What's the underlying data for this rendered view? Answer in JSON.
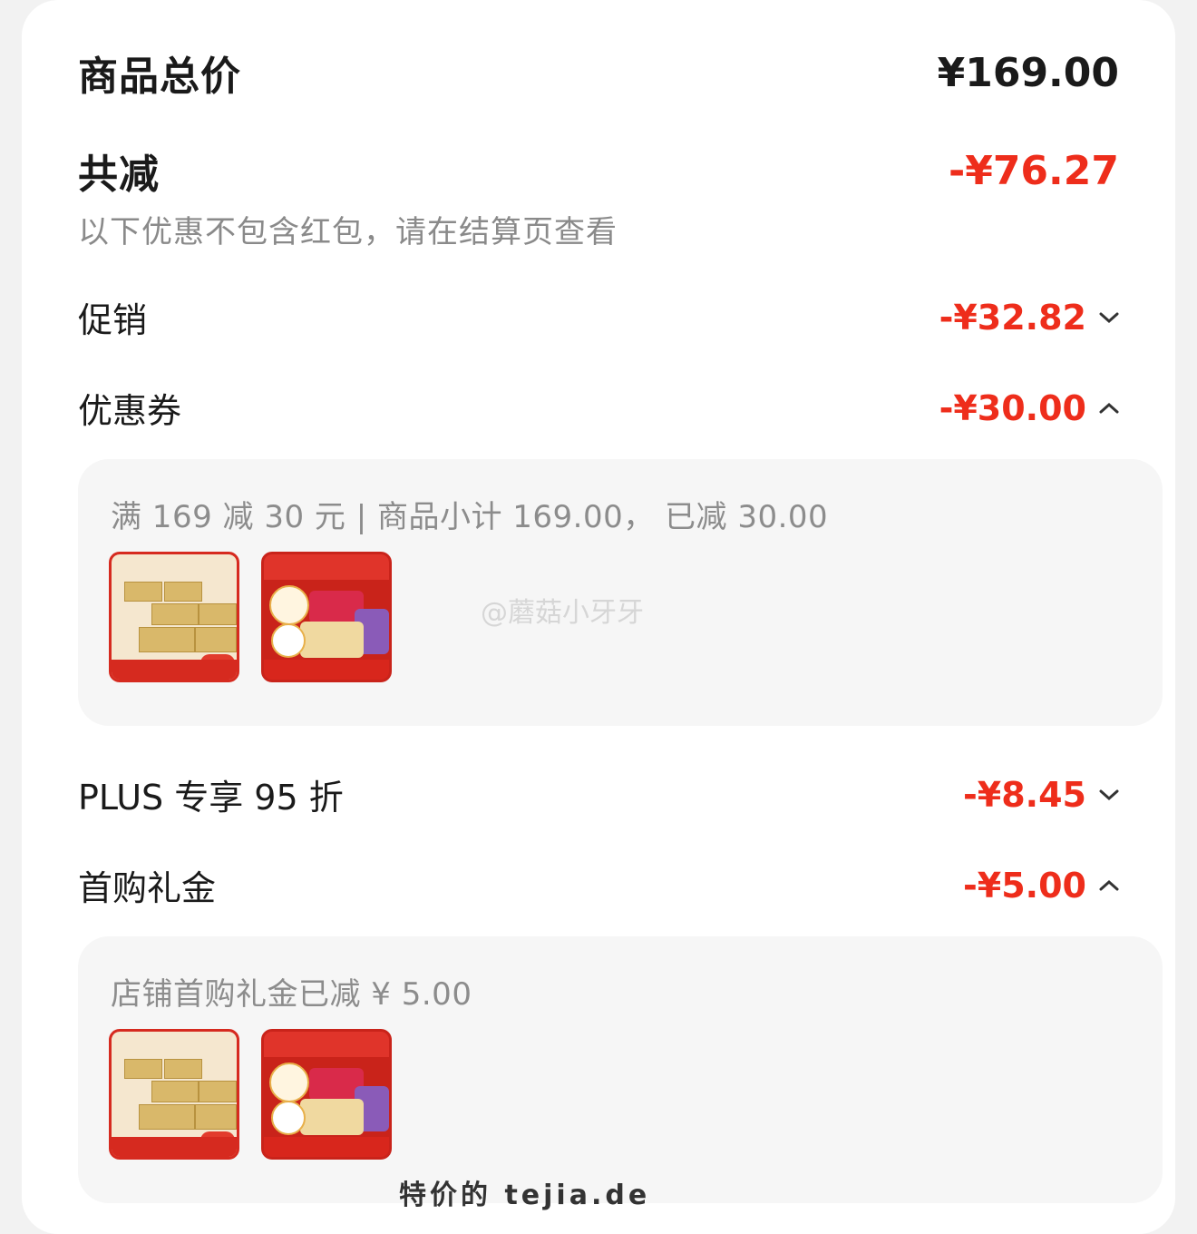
{
  "summary": {
    "total_label": "商品总价",
    "total_value": "¥169.00",
    "reduce_label": "共减",
    "reduce_value": "-¥76.27",
    "note": "以下优惠不包含红包，请在结算页查看"
  },
  "items": [
    {
      "label": "促销",
      "value": "-¥32.82",
      "expanded": false
    },
    {
      "label": "优惠券",
      "value": "-¥30.00",
      "expanded": true
    },
    {
      "label": "PLUS 专享 95 折",
      "value": "-¥8.45",
      "expanded": false
    },
    {
      "label": "首购礼金",
      "value": "-¥5.00",
      "expanded": true
    }
  ],
  "coupon_panel": {
    "text": "满 169 减 30 元 | 商品小计 169.00， 已减 30.00"
  },
  "gift_panel": {
    "text": "店铺首购礼金已减 ¥ 5.00"
  },
  "watermark": "@蘑菇小牙牙",
  "footer": "特价的  tejia.de",
  "colors": {
    "accent": "#ee2d1b",
    "panel": "#f6f6f6"
  },
  "icons": {
    "collapsed": "chevron-down-icon",
    "expanded": "chevron-up-icon"
  }
}
